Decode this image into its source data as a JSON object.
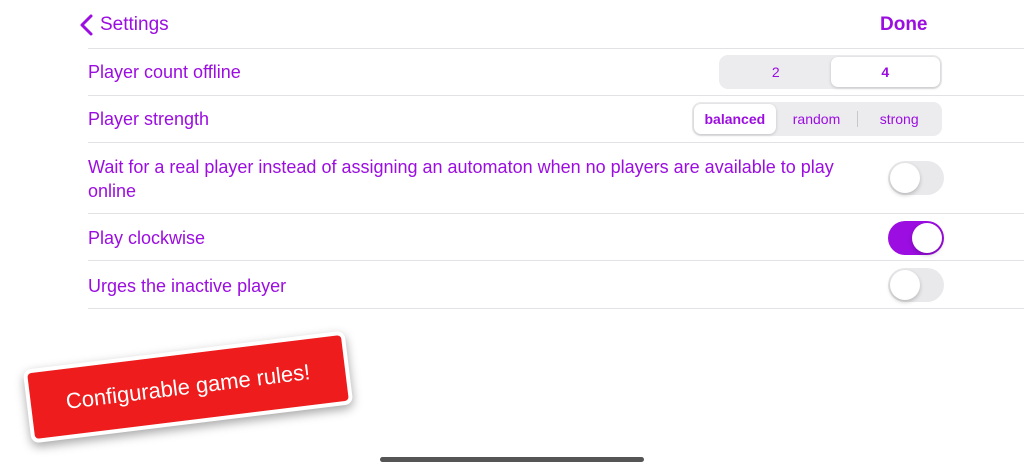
{
  "nav": {
    "back_label": "Settings",
    "done_label": "Done"
  },
  "rows": {
    "player_count": {
      "label": "Player count offline",
      "options": [
        "2",
        "4"
      ],
      "selected": "4"
    },
    "player_strength": {
      "label": "Player strength",
      "options": [
        "balanced",
        "random",
        "strong"
      ],
      "selected": "balanced"
    },
    "wait_real_player": {
      "label": "Wait for a real player instead of assigning an automaton when no players are available to play online",
      "on": false
    },
    "play_clockwise": {
      "label": "Play clockwise",
      "on": true
    },
    "urges_inactive": {
      "label": "Urges the inactive player",
      "on": false
    }
  },
  "banner": {
    "text": "Configurable game rules!"
  },
  "colors": {
    "accent": "#9b0de0",
    "banner": "#ee1c1c"
  }
}
